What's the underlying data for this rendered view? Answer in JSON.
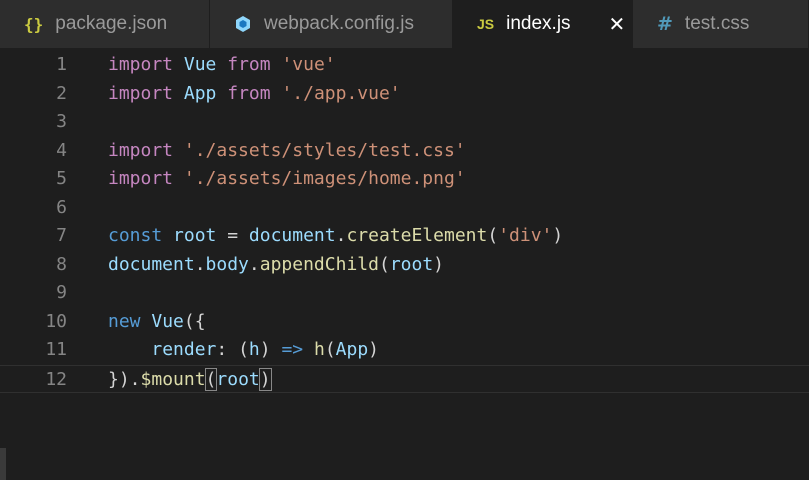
{
  "tabs": [
    {
      "label": "package.json",
      "icon": "braces-icon",
      "glyph": "{}",
      "active": false
    },
    {
      "label": "webpack.config.js",
      "icon": "webpack-cube-icon",
      "active": false
    },
    {
      "label": "index.js",
      "icon": "js-icon",
      "glyph": "JS",
      "active": true
    },
    {
      "label": "test.css",
      "icon": "hash-icon",
      "glyph": "#",
      "active": false
    }
  ],
  "close_glyph": "✕",
  "lines": [
    {
      "num": "1",
      "tokens": [
        {
          "t": "import",
          "c": "kw2"
        },
        {
          "t": " "
        },
        {
          "t": "Vue",
          "c": "id"
        },
        {
          "t": " "
        },
        {
          "t": "from",
          "c": "kw2"
        },
        {
          "t": " "
        },
        {
          "t": "'vue'",
          "c": "str"
        }
      ]
    },
    {
      "num": "2",
      "tokens": [
        {
          "t": "import",
          "c": "kw2"
        },
        {
          "t": " "
        },
        {
          "t": "App",
          "c": "id"
        },
        {
          "t": " "
        },
        {
          "t": "from",
          "c": "kw2"
        },
        {
          "t": " "
        },
        {
          "t": "'./app.vue'",
          "c": "str"
        }
      ]
    },
    {
      "num": "3",
      "tokens": []
    },
    {
      "num": "4",
      "tokens": [
        {
          "t": "import",
          "c": "kw2"
        },
        {
          "t": " "
        },
        {
          "t": "'./assets/styles/test.css'",
          "c": "str"
        }
      ]
    },
    {
      "num": "5",
      "tokens": [
        {
          "t": "import",
          "c": "kw2"
        },
        {
          "t": " "
        },
        {
          "t": "'./assets/images/home.png'",
          "c": "str"
        }
      ]
    },
    {
      "num": "6",
      "tokens": []
    },
    {
      "num": "7",
      "tokens": [
        {
          "t": "const",
          "c": "kw"
        },
        {
          "t": " "
        },
        {
          "t": "root",
          "c": "id"
        },
        {
          "t": " = "
        },
        {
          "t": "document",
          "c": "id"
        },
        {
          "t": "."
        },
        {
          "t": "createElement",
          "c": "fn"
        },
        {
          "t": "("
        },
        {
          "t": "'div'",
          "c": "str"
        },
        {
          "t": ")"
        }
      ]
    },
    {
      "num": "8",
      "tokens": [
        {
          "t": "document",
          "c": "id"
        },
        {
          "t": "."
        },
        {
          "t": "body",
          "c": "id"
        },
        {
          "t": "."
        },
        {
          "t": "appendChild",
          "c": "fn"
        },
        {
          "t": "("
        },
        {
          "t": "root",
          "c": "id"
        },
        {
          "t": ")"
        }
      ]
    },
    {
      "num": "9",
      "tokens": []
    },
    {
      "num": "10",
      "tokens": [
        {
          "t": "new",
          "c": "kw"
        },
        {
          "t": " "
        },
        {
          "t": "Vue",
          "c": "id"
        },
        {
          "t": "({"
        }
      ]
    },
    {
      "num": "11",
      "tokens": [
        {
          "t": "    "
        },
        {
          "t": "render",
          "c": "id"
        },
        {
          "t": ": ("
        },
        {
          "t": "h",
          "c": "id"
        },
        {
          "t": ") "
        },
        {
          "t": "=>",
          "c": "kw"
        },
        {
          "t": " "
        },
        {
          "t": "h",
          "c": "fn"
        },
        {
          "t": "("
        },
        {
          "t": "App",
          "c": "id"
        },
        {
          "t": ")"
        }
      ]
    },
    {
      "num": "12",
      "current": true,
      "tokens": [
        {
          "t": "})."
        },
        {
          "t": "$mount",
          "c": "fn"
        },
        {
          "t": "(",
          "hl": true
        },
        {
          "t": "root",
          "c": "id"
        },
        {
          "t": ")",
          "hl": true
        }
      ]
    }
  ]
}
